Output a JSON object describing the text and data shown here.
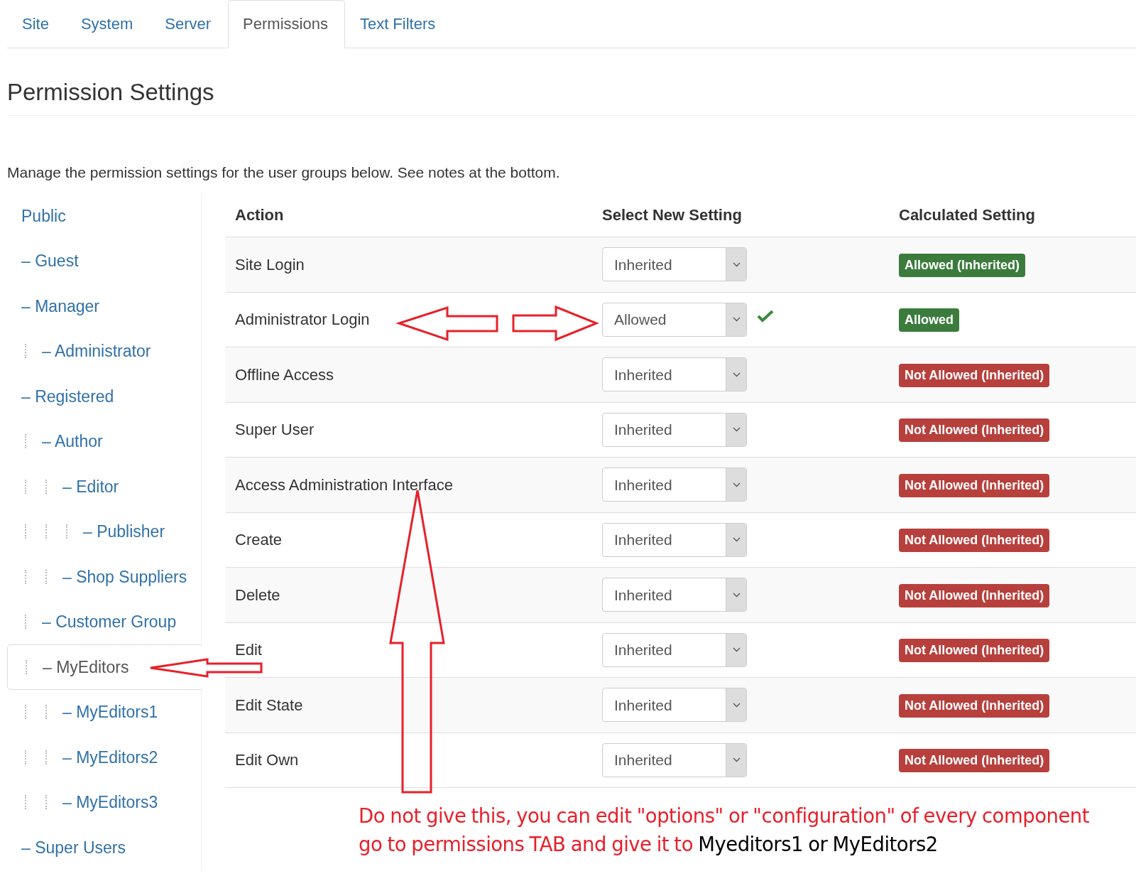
{
  "tabs": [
    {
      "label": "Site",
      "selected": false
    },
    {
      "label": "System",
      "selected": false
    },
    {
      "label": "Server",
      "selected": false
    },
    {
      "label": "Permissions",
      "selected": true
    },
    {
      "label": "Text Filters",
      "selected": false
    }
  ],
  "heading": "Permission Settings",
  "intro": "Manage the permission settings for the user groups below. See notes at the bottom.",
  "groups": [
    {
      "label": "Public",
      "selected": false,
      "children": [
        {
          "label": "– Guest",
          "selected": false
        },
        {
          "label": "– Manager",
          "selected": false,
          "children": [
            {
              "label": "– Administrator",
              "selected": false
            }
          ]
        },
        {
          "label": "– Registered",
          "selected": false,
          "children": [
            {
              "label": "– Author",
              "selected": false,
              "children": [
                {
                  "label": "– Editor",
                  "selected": false,
                  "children": [
                    {
                      "label": "– Publisher",
                      "selected": false
                    }
                  ]
                },
                {
                  "label": "– Shop Suppliers",
                  "selected": false
                }
              ]
            },
            {
              "label": "– Customer Group",
              "selected": false
            },
            {
              "label": "– MyEditors",
              "selected": true,
              "children": [
                {
                  "label": "– MyEditors1",
                  "selected": false
                },
                {
                  "label": "– MyEditors2",
                  "selected": false
                },
                {
                  "label": "– MyEditors3",
                  "selected": false
                }
              ]
            }
          ]
        },
        {
          "label": "– Super Users",
          "selected": false
        }
      ]
    }
  ],
  "table": {
    "columns": [
      "Action",
      "Select New Setting",
      "Calculated Setting"
    ],
    "rows": [
      {
        "action": "Site Login",
        "setting": "Inherited",
        "saved": false,
        "calculated": "Allowed (Inherited)",
        "kind": "allowed"
      },
      {
        "action": "Administrator Login",
        "setting": "Allowed",
        "saved": true,
        "calculated": "Allowed",
        "kind": "allowed"
      },
      {
        "action": "Offline Access",
        "setting": "Inherited",
        "saved": false,
        "calculated": "Not Allowed (Inherited)",
        "kind": "denied"
      },
      {
        "action": "Super User",
        "setting": "Inherited",
        "saved": false,
        "calculated": "Not Allowed (Inherited)",
        "kind": "denied"
      },
      {
        "action": "Access Administration Interface",
        "setting": "Inherited",
        "saved": false,
        "calculated": "Not Allowed (Inherited)",
        "kind": "denied"
      },
      {
        "action": "Create",
        "setting": "Inherited",
        "saved": false,
        "calculated": "Not Allowed (Inherited)",
        "kind": "denied"
      },
      {
        "action": "Delete",
        "setting": "Inherited",
        "saved": false,
        "calculated": "Not Allowed (Inherited)",
        "kind": "denied"
      },
      {
        "action": "Edit",
        "setting": "Inherited",
        "saved": false,
        "calculated": "Not Allowed (Inherited)",
        "kind": "denied"
      },
      {
        "action": "Edit State",
        "setting": "Inherited",
        "saved": false,
        "calculated": "Not Allowed (Inherited)",
        "kind": "denied"
      },
      {
        "action": "Edit Own",
        "setting": "Inherited",
        "saved": false,
        "calculated": "Not Allowed (Inherited)",
        "kind": "denied"
      }
    ]
  },
  "annotation": {
    "parts": [
      {
        "text": "Do not give this, you can edit \"options\" or \"configuration\" of every component\ngo to permissions TAB and give it to ",
        "color": "#e8202a"
      },
      {
        "text": "Myeditors1 or MyEditors2",
        "color": "#000000"
      }
    ]
  }
}
